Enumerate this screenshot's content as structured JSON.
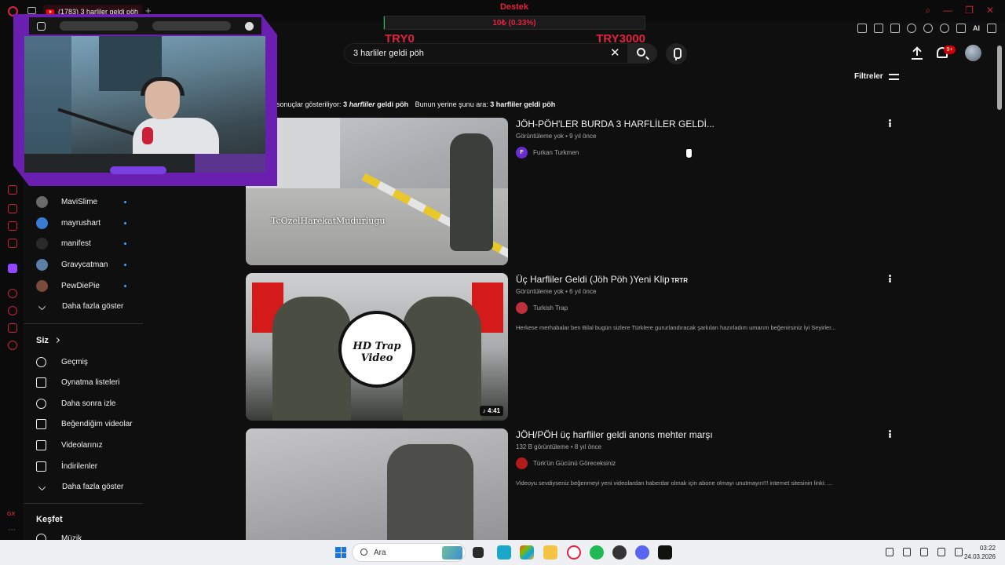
{
  "browser": {
    "tab_title": "(1783) 3 harliler geldi pöh",
    "new_tab": "+",
    "window_controls": [
      "⌕",
      "—",
      "❐",
      "✕"
    ],
    "toolbar_ai": "AI"
  },
  "donation": {
    "title": "Destek",
    "amount": "10₺ (0.33%)",
    "progress_percent": 0.33,
    "min_label": "TRY0",
    "max_label": "TRY3000",
    "colors": {
      "text": "#e0233f",
      "fill": "#1fc74b"
    }
  },
  "search": {
    "query": "3 harliler geldi pöh",
    "clear": "✕"
  },
  "header": {
    "notification_count": "9+",
    "filters_label": "Filtreler"
  },
  "spelling": {
    "showing_prefix": "sonuçlar gösteriliyor:",
    "showing_num": "3",
    "showing_word": "harfliler",
    "showing_rest": "geldi pöh",
    "instead_prefix": "Bunun yerine şunu ara:",
    "instead_query": "3 harfliler geldi pöh"
  },
  "sidebar": {
    "subscriptions": [
      {
        "label": "MaviSlime",
        "color": "#6a6a6a"
      },
      {
        "label": "mayrushart",
        "color": "#3a7bd5"
      },
      {
        "label": "manifest",
        "color": "#222222"
      },
      {
        "label": "Gravycatman",
        "color": "#5b7fa6"
      },
      {
        "label": "PewDiePie",
        "color": "#7a4b3a"
      }
    ],
    "show_more_1": "Daha fazla göster",
    "you_heading": "Siz",
    "you_items": [
      {
        "label": "Geçmiş",
        "icon": "history-icon"
      },
      {
        "label": "Oynatma listeleri",
        "icon": "playlists-icon"
      },
      {
        "label": "Daha sonra izle",
        "icon": "watch-later-icon"
      },
      {
        "label": "Beğendiğim videolar",
        "icon": "like-icon"
      },
      {
        "label": "Videolarınız",
        "icon": "your-videos-icon"
      },
      {
        "label": "İndirilenler",
        "icon": "download-icon"
      }
    ],
    "show_more_2": "Daha fazla göster",
    "explore_heading": "Keşfet",
    "explore_first": "Müzik"
  },
  "results": [
    {
      "title": "JÖH-PÖH'LER BURDA 3 HARFLİLER GELDİ...",
      "title_suffix": "",
      "meta": "Görüntüleme yok • 9 yıl önce",
      "channel": "Furkan Turkmen",
      "channel_initial": "F",
      "channel_color": "#6a2bd0",
      "description": "",
      "duration": "",
      "watermark": "TcOzelHarekatMudurlugu"
    },
    {
      "title": "Üç Harfliler Geldi (Jöh Pöh )Yeni Klip",
      "title_suffix": "TRTR",
      "meta": "Görüntüleme yok • 6 yıl önce",
      "channel": "Turkish Trap",
      "channel_initial": "",
      "channel_color": "#c0303a",
      "description": "Herkese merhabalar ben Bilal bugün sizlere Türklere gururlandıracak şarkıları hazırladım umarım beğenirsiniz İyi Seyirler...",
      "duration": "♪ 4:41",
      "logo_text": "HD Trap Video"
    },
    {
      "title": "JÖH/PÖH üç harfliler geldi anons mehter marşı",
      "title_suffix": "",
      "meta": "132 B görüntüleme • 8 yıl önce",
      "channel": "Türk'ün Gücünü Göreceksiniz",
      "channel_initial": "",
      "channel_color": "#b31a1a",
      "description": "Videoyu sevdiyseniz beğenmeyi yeni videolardan haberdar olmak için abone olmayı unutmayın!!! internet sitesinin linki: ...",
      "duration": ""
    }
  ],
  "taskbar": {
    "search_label": "Ara",
    "time": "03:22",
    "date": "24.03.2026"
  }
}
